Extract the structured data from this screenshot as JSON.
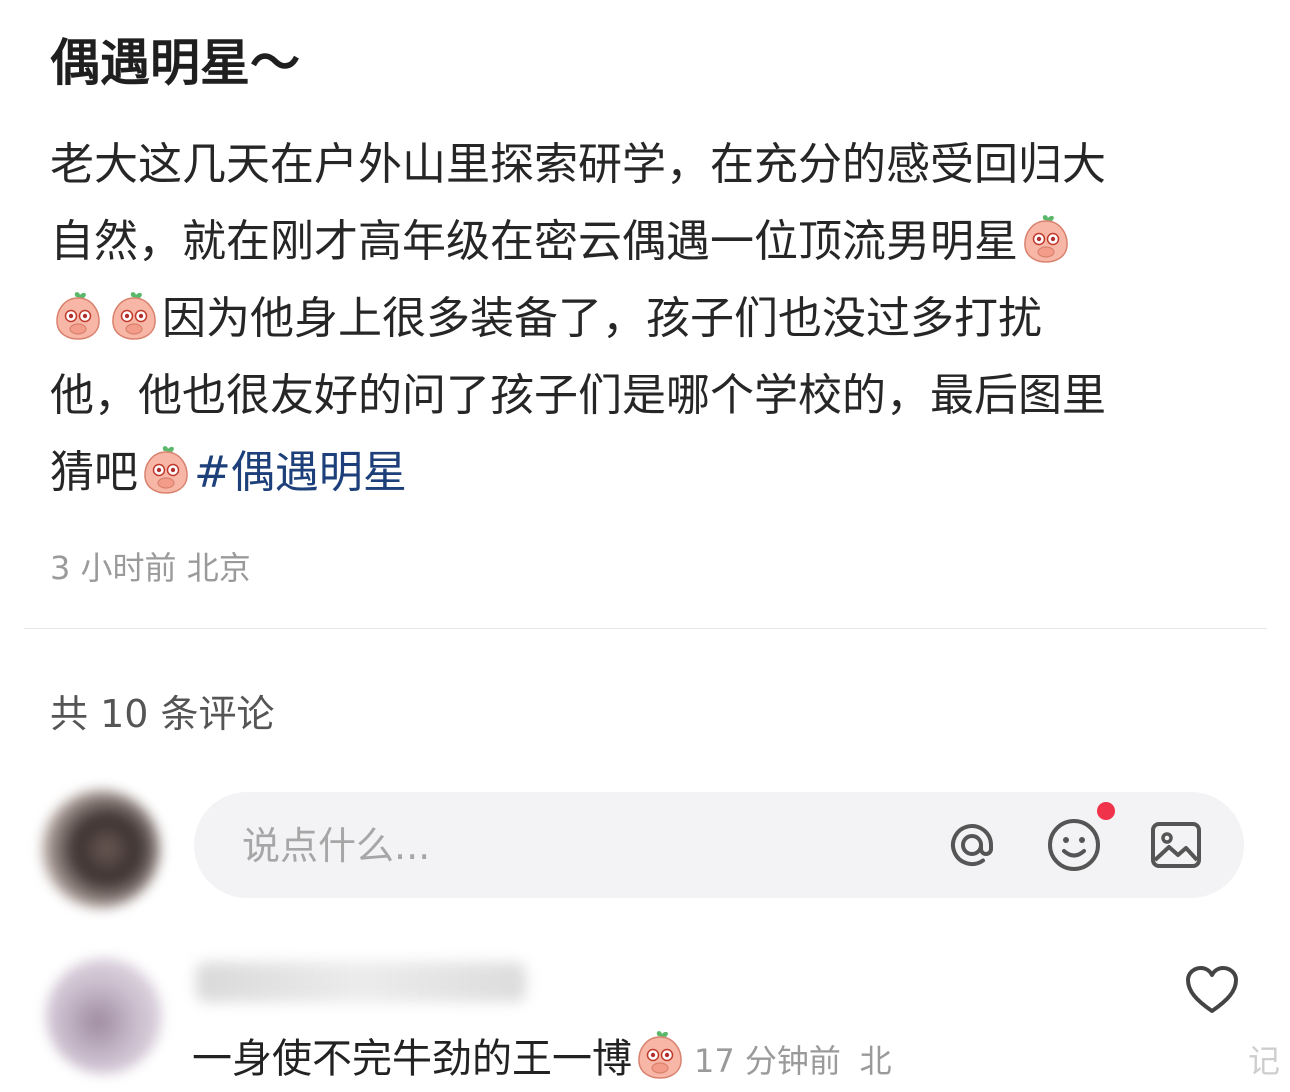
{
  "post": {
    "title": "偶遇明星～",
    "lines": [
      "老大这几天在户外山里探索研学，在充分的感受回归大",
      "自然，就在刚才高年级在密云偶遇一位顶流男明星",
      "因为他身上很多装备了，孩子们也没过多打扰",
      "他，他也很友好的问了孩子们是哪个学校的，最后图里",
      "猜吧"
    ],
    "hashtag": "#偶遇明星",
    "time": "3 小时前",
    "location": "北京"
  },
  "comments_section": {
    "count_label": "共 10 条评论",
    "input_placeholder": "说点什么...",
    "icons": {
      "mention": "at-icon",
      "emoji": "smiley-icon",
      "image": "image-icon",
      "notify_color": "#f0324b"
    }
  },
  "comment": {
    "text": "一身使不完牛劲的王一博",
    "time": "17 分钟前",
    "location": "北",
    "watermark": "记"
  },
  "colors": {
    "hashtag": "#1d3f7a",
    "meta": "#9a9a9a",
    "input_bg": "#f3f3f5"
  }
}
